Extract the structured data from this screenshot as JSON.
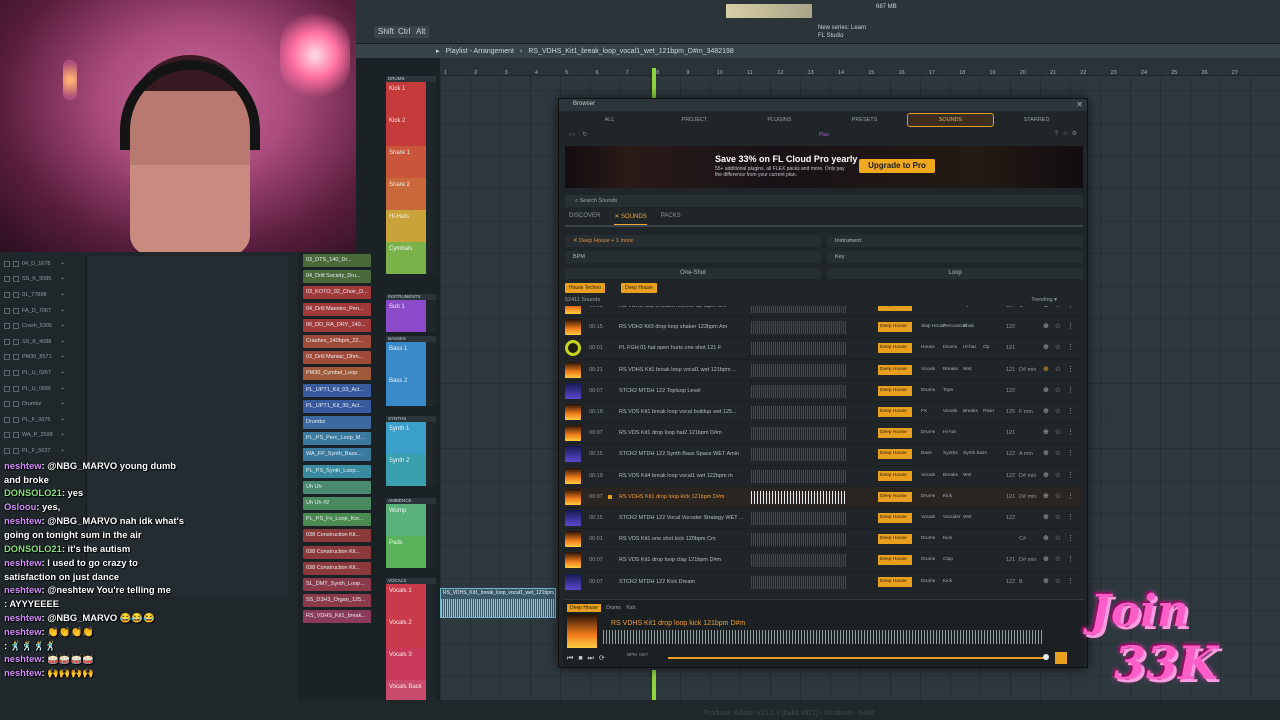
{
  "window": {
    "mem": "687 MB",
    "news_line1": "New series: Learn",
    "news_line2": "FL Studio",
    "shift": "Shift",
    "ctrl": "Ctrl",
    "alt": "Alt"
  },
  "playlist": {
    "title": "Playlist - Arrangement",
    "pattern": "RS_VDHS_Kit1_break_loop_vocal1_wet_121bpm_D#m_3482198",
    "ruler": [
      "1",
      "2",
      "3",
      "4",
      "5",
      "6",
      "7",
      "8",
      "9",
      "10",
      "11",
      "12",
      "13",
      "14",
      "15",
      "16",
      "17",
      "18",
      "19",
      "20",
      "21",
      "22",
      "23",
      "24",
      "25",
      "26",
      "27"
    ],
    "clip_label": "RS_VDHS_Kit1_break_loop_vocal1_wet_121bpm_D#m_3482198"
  },
  "tracks": [
    {
      "cat": "DRUMS",
      "name": "Kick 1",
      "color": "#c43a3a"
    },
    {
      "cat": "",
      "name": "Kick 2",
      "color": "#c43a3a"
    },
    {
      "cat": "",
      "name": "Snare 1",
      "color": "#c9563a"
    },
    {
      "cat": "",
      "name": "Snare 2",
      "color": "#c9683a"
    },
    {
      "cat": "",
      "name": "Hi-Hats",
      "color": "#c9a33a"
    },
    {
      "cat": "",
      "name": "Cymbals",
      "color": "#7ab24a"
    },
    {
      "cat": "INSTRUMENTS",
      "name": "Sub 1",
      "color": "#8a4ac9"
    },
    {
      "cat": "BASSES",
      "name": "Bass 1",
      "color": "#3a8ac9"
    },
    {
      "cat": "",
      "name": "Bass 2",
      "color": "#3a8ac9"
    },
    {
      "cat": "SYNTHS",
      "name": "Synth 1",
      "color": "#3aa0c9"
    },
    {
      "cat": "",
      "name": "Synth 2",
      "color": "#3aa0b0"
    },
    {
      "cat": "AMBIENCE",
      "name": "Womp",
      "color": "#5ab27a"
    },
    {
      "cat": "",
      "name": "Pads",
      "color": "#5ab25a"
    },
    {
      "cat": "VOCALS",
      "name": "Vocals 1",
      "color": "#c93a4a"
    },
    {
      "cat": "",
      "name": "Vocals 2",
      "color": "#c93a4a"
    },
    {
      "cat": "",
      "name": "Vocals 3",
      "color": "#c93a5a"
    },
    {
      "cat": "",
      "name": "Vocals Back",
      "color": "#c94a6a"
    }
  ],
  "picker": [
    {
      "name": "03_DTS_140_Dr...",
      "color": "#4a6a3a"
    },
    {
      "name": "04_Drill Society_Dru...",
      "color": "#4a6a3a"
    },
    {
      "name": "03_KOTO_02_Choir_D...",
      "color": "#a03a3a"
    },
    {
      "name": "04_Drill Maestro_Pen...",
      "color": "#a03a3a"
    },
    {
      "name": "06_DD_RA_DRY_140...",
      "color": "#a03a3a"
    },
    {
      "name": "Crashes_140bpm_22...",
      "color": "#a04a3a"
    },
    {
      "name": "03_Drill Maniac_Dhm...",
      "color": "#a04a3a"
    },
    {
      "name": "PM30_Cymbal_Loop",
      "color": "#a05a3a"
    },
    {
      "name": "PL_UPT1_Kit_03_Aci...",
      "color": "#3a5aa0"
    },
    {
      "name": "PL_UPT1_Kit_30_Aci...",
      "color": "#3a5aa0"
    },
    {
      "name": "Drumbz",
      "color": "#3a6aa0"
    },
    {
      "name": "PL_PS_Perc_Loop_M...",
      "color": "#3a7aa0"
    },
    {
      "name": "WA_FP_Synth_Bass...",
      "color": "#3a7aa0"
    },
    {
      "name": "PL_PS_Synth_Loop...",
      "color": "#3a8aa0"
    },
    {
      "name": "Uh Uh",
      "color": "#4a8a70"
    },
    {
      "name": "Uh Uh #2",
      "color": "#4a8a60"
    },
    {
      "name": "PL_PS_Fx_Loop_Kor...",
      "color": "#4a8a50"
    },
    {
      "name": "038 Construction Kit...",
      "color": "#8a3a3a"
    },
    {
      "name": "038 Construction Kit...",
      "color": "#8a3a3a"
    },
    {
      "name": "038 Construction Kit...",
      "color": "#8a3a3a"
    },
    {
      "name": "SL_DMT_Synth_Loop...",
      "color": "#8a3a4a"
    },
    {
      "name": "SS_D3H3_Organ_125...",
      "color": "#8a3a4a"
    },
    {
      "name": "RS_VDHS_Kit1_break...",
      "color": "#8a3a5a"
    }
  ],
  "mixer": [
    "04_D_1678",
    "SS_K_9085",
    "01_77898",
    "FA_D_7067",
    "Crash_5305",
    "SS_K_4088",
    "PM30_8571",
    "PL_U_0267",
    "PL_U_0686",
    "Drumbz",
    "PL_F_9375",
    "WA_P_2598",
    "PL_F_5637"
  ],
  "chat": [
    {
      "user": "neshtew",
      "msg": ": @NBG_MARVO young dumb",
      "green": false
    },
    {
      "user": "",
      "msg": "and broke",
      "green": false
    },
    {
      "user": "DONSOLO21",
      "msg": ": yes",
      "green": true
    },
    {
      "user": "Osloou",
      "msg": ": yes,",
      "green": false
    },
    {
      "user": "neshtew",
      "msg": ": @NBG_MARVO nah idk what's",
      "green": false
    },
    {
      "user": "",
      "msg": "going on tonight sum in the air",
      "green": false
    },
    {
      "user": "DONSOLO21",
      "msg": ": it's the autism",
      "green": true
    },
    {
      "user": "neshtew",
      "msg": ": I used to go crazy to",
      "green": false
    },
    {
      "user": "",
      "msg": "satisfaction on just dance",
      "green": false
    },
    {
      "user": "neshtew",
      "msg": ": @neshtew You're telling me",
      "green": false
    },
    {
      "user": "",
      "msg": ": AYYYEEEE",
      "green": false
    },
    {
      "user": "neshtew",
      "msg": ": @NBG_MARVO 😂😂😂",
      "green": false
    },
    {
      "user": "neshtew",
      "msg": ": 👏👏👏👏",
      "green": false
    },
    {
      "user": "",
      "msg": ": 🕺🕺🕺🕺",
      "green": false
    },
    {
      "user": "neshtew",
      "msg": ": 🥁🥁🥁🥁",
      "green": false
    },
    {
      "user": "neshtew",
      "msg": ": 🙌🙌🙌🙌",
      "green": false
    }
  ],
  "browser": {
    "title": "Browser",
    "tabs": [
      "ALL",
      "PROJECT",
      "PLUGINS",
      "PRESETS",
      "SOUNDS",
      "STARRED"
    ],
    "active_tab": 4,
    "fav_label": "Plus",
    "banner_title": "Save 33% on FL Cloud Pro yearly",
    "banner_sub": "55+ additional plugins, all FLEX packs and more. Only pay the difference from your current plan.",
    "upgrade": "Upgrade to Pro",
    "search_placeholder": "Search Sounds",
    "subtabs": [
      "DISCOVER",
      "SOUNDS",
      "PACKS"
    ],
    "filter_genre": "Deep House + 1 more",
    "filter_instrument": "Instrument",
    "filter_bpm": "BPM",
    "filter_key": "Key",
    "toggle_one": "One-Shot",
    "toggle_loop": "Loop",
    "chips": [
      "House Techno",
      "Deep House"
    ],
    "count": "52411 Sounds",
    "sort": "Trending",
    "accent": "#e89f1e"
  },
  "sounds": [
    {
      "dur": "00:03",
      "name": "RS VDH5 Kit3 fx crash reverse 124bpm Gm",
      "t": [
        "Deep House",
        "Drums",
        "FX",
        "Cymbals",
        "Reve"
      ],
      "bpm": "124",
      "key": "G",
      "thumb": "fire"
    },
    {
      "dur": "00:15",
      "name": "RS VDH2 Kit3 drop loop shaker 122bpm Am",
      "t": [
        "Deep House",
        "Slap House",
        "Percussion",
        "Shak"
      ],
      "bpm": "122",
      "key": "",
      "thumb": "fire"
    },
    {
      "dur": "00:01",
      "name": "PL FGH 01 hat open hurts one shot 121 F",
      "t": [
        "Deep House",
        "House",
        "Drums",
        "Hi-hat",
        "Op"
      ],
      "bpm": "121",
      "key": "",
      "thumb": "ring"
    },
    {
      "dur": "00:21",
      "name": "RS VDHS Kit1 break loop vocal1 wet 121bpm ...",
      "t": [
        "Deep House",
        "Vocals",
        "Breaks",
        "Wet"
      ],
      "bpm": "121",
      "key": "D# min",
      "thumb": "fire"
    },
    {
      "dur": "00:07",
      "name": "STCR2 MTDH 122 Topluop Level",
      "t": [
        "Deep House",
        "Drums",
        "Tops"
      ],
      "bpm": "122",
      "key": "",
      "thumb": "blue"
    },
    {
      "dur": "00:18",
      "name": "RS VDS Kit1 break loop vocal buildup wet 125...",
      "t": [
        "Deep House",
        "FX",
        "Vocals",
        "Breaks",
        "Riser"
      ],
      "bpm": "125",
      "key": "F min",
      "thumb": "fire"
    },
    {
      "dur": "00:07",
      "name": "RS VDS Kit1 drop loop hat2 121bpm D#m",
      "t": [
        "Deep House",
        "Drums",
        "Hi-hat"
      ],
      "bpm": "121",
      "key": "",
      "thumb": "fire"
    },
    {
      "dur": "00:15",
      "name": "STCR2 MTDH 122 Synth Bass Space WET Amin",
      "t": [
        "Deep House",
        "Bass",
        "Synths",
        "Synth bass"
      ],
      "bpm": "122",
      "key": "A min",
      "thumb": "blue"
    },
    {
      "dur": "00:19",
      "name": "RS VDS Kit4 break loop vocal1 wet 122bpm m",
      "t": [
        "Deep House",
        "Vocals",
        "Breaks",
        "Wet"
      ],
      "bpm": "122",
      "key": "D# min",
      "thumb": "fire"
    },
    {
      "dur": "00:07",
      "name": "RS VDHS Kit1 drop loop kick 121bpm D#m",
      "t": [
        "Deep House",
        "Drums",
        "Kick"
      ],
      "bpm": "121",
      "key": "D# min",
      "thumb": "fire",
      "selected": true
    },
    {
      "dur": "00:15",
      "name": "STCR2 MTDH 122 Vocal Vocoder Strategy WET ...",
      "t": [
        "Deep House",
        "Vocals",
        "Vocoder",
        "Wet"
      ],
      "bpm": "122",
      "key": "",
      "thumb": "blue"
    },
    {
      "dur": "00:01",
      "name": "RS VDS Kit1 one shot kick 120bpm Cm",
      "t": [
        "Deep House",
        "Drums",
        "Kick"
      ],
      "bpm": "",
      "key": "C#",
      "thumb": "fire"
    },
    {
      "dur": "00:07",
      "name": "RS VDS Kit1 drop loop clap 121bpm D#m",
      "t": [
        "Deep House",
        "Drums",
        "Clap"
      ],
      "bpm": "121",
      "key": "D# min",
      "thumb": "fire"
    },
    {
      "dur": "00:07",
      "name": "STCR2 MTDH 122 Kick Dream",
      "t": [
        "Deep House",
        "Drums",
        "Kick"
      ],
      "bpm": "122",
      "key": "B",
      "thumb": "blue"
    }
  ],
  "player": {
    "tags": [
      "Deep House",
      "Drums",
      "Kick"
    ],
    "name": "RS VDHS Kit1 drop loop kick 121bpm D#m",
    "bpm_label": "BPM",
    "key_label": "KEY"
  },
  "statusbar": "Producer Edition v25.1.3 [build 4927] - Windows - 64Bit",
  "overlay": {
    "line1": "Join",
    "line2": "33K"
  }
}
